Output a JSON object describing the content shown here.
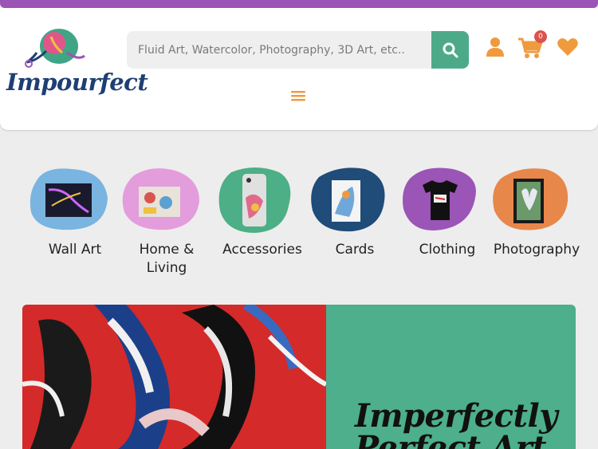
{
  "brand": {
    "name": "Impourfect",
    "accent": "#4daa88",
    "top_bar_color": "#9b55b6",
    "icon_color": "#f09a3e"
  },
  "search": {
    "placeholder": "Fluid Art, Watercolor, Photography, 3D Art, etc..",
    "icon": "search-icon"
  },
  "header_icons": {
    "account": "user-icon",
    "cart": "cart-icon",
    "cart_count": "0",
    "wishlist": "heart-icon",
    "menu": "hamburger-icon"
  },
  "categories": [
    {
      "label": "Wall Art",
      "color": "#7ab4e0"
    },
    {
      "label": "Home & Living",
      "color": "#e39cdc"
    },
    {
      "label": "Accessories",
      "color": "#4caf86"
    },
    {
      "label": "Cards",
      "color": "#1f4c79"
    },
    {
      "label": "Clothing",
      "color": "#9b55b6"
    },
    {
      "label": "Photography",
      "color": "#e8874a"
    }
  ],
  "hero": {
    "title": "Imperfectly Perfect Art",
    "panel_color": "#4daf8c"
  }
}
